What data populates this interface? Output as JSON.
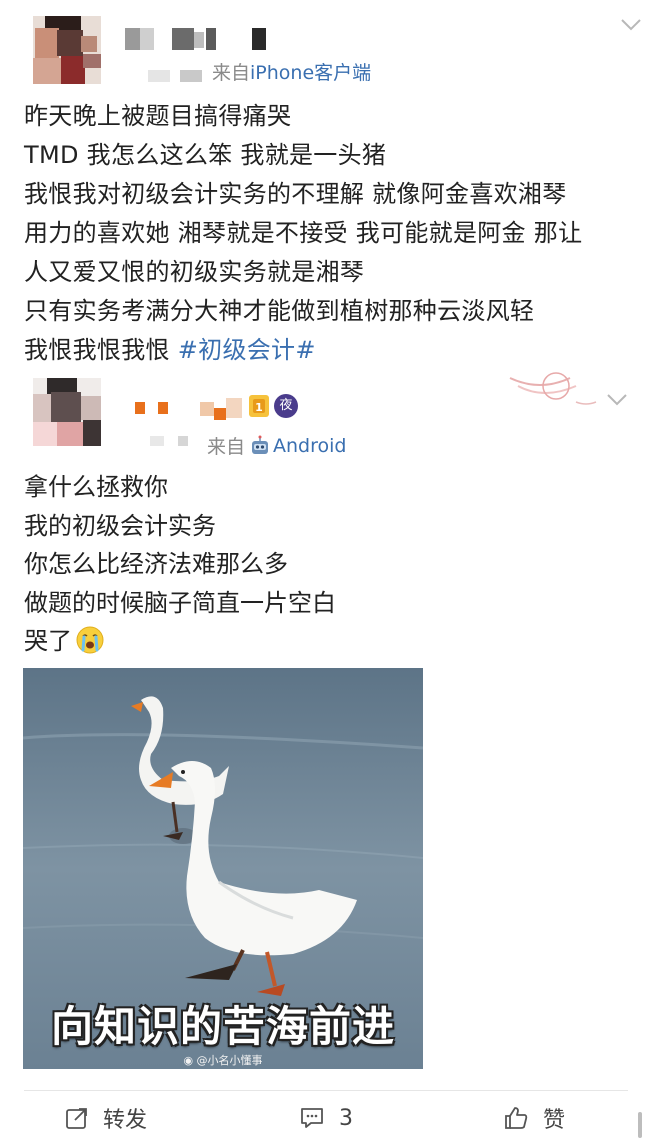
{
  "posts": [
    {
      "source_prefix": "来自",
      "client": "iPhone客户端",
      "lines": [
        "昨天晚上被题目搞得痛哭",
        "TMD 我怎么这么笨 我就是一头猪",
        "我恨我对初级会计实务的不理解 就像阿金喜欢湘琴",
        "用力的喜欢她 湘琴就是不接受 我可能就是阿金 那让",
        "人又爱又恨的初级实务就是湘琴",
        "只有实务考满分大神才能做到植树那种云淡风轻"
      ],
      "last_line_text": "我恨我恨我恨 ",
      "hashtag": "#初级会计#"
    },
    {
      "source_prefix": "来自",
      "client": "Android",
      "badge_label": "夜",
      "lines": [
        "拿什么拯救你",
        "我的初级会计实务",
        "你怎么比经济法难那么多",
        "做题的时候脑子简直一片空白",
        "哭了"
      ],
      "image": {
        "caption": "向知识的苦海前进",
        "watermark": "@小名小懂事"
      }
    }
  ],
  "actions": {
    "repost_label": "转发",
    "comment_count": "3",
    "like_label": "赞"
  },
  "icons": [
    "chevron-down-icon",
    "robot-icon",
    "crying-face-icon",
    "repost-icon",
    "comment-icon",
    "like-icon"
  ],
  "colors": {
    "link_blue": "#3a6fb0",
    "meta_gray": "#8a8a8a",
    "text": "#222222"
  }
}
